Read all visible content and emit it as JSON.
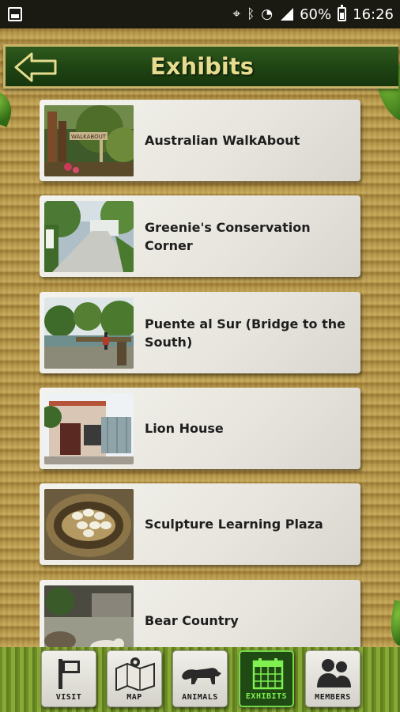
{
  "status_bar": {
    "battery": "60%",
    "time": "16:26"
  },
  "header": {
    "title": "Exhibits"
  },
  "exhibits": [
    {
      "name": "Australian WalkAbout",
      "thumb_sign": "WALKABOUT"
    },
    {
      "name": "Greenie's Conservation Corner"
    },
    {
      "name": "Puente al Sur (Bridge to the South)"
    },
    {
      "name": "Lion House"
    },
    {
      "name": "Sculpture Learning Plaza"
    },
    {
      "name": "Bear Country"
    }
  ],
  "nav": [
    {
      "label": "VISIT",
      "icon": "sign-icon",
      "active": false
    },
    {
      "label": "MAP",
      "icon": "map-icon",
      "active": false
    },
    {
      "label": "ANIMALS",
      "icon": "panther-icon",
      "active": false
    },
    {
      "label": "EXHIBITS",
      "icon": "calendar-icon",
      "active": true
    },
    {
      "label": "MEMBERS",
      "icon": "members-icon",
      "active": false
    }
  ],
  "colors": {
    "header_bg": "#1e4312",
    "header_title": "#e6dc8f",
    "active_nav": "#7ff050",
    "card_bg": "#f0efe9"
  }
}
